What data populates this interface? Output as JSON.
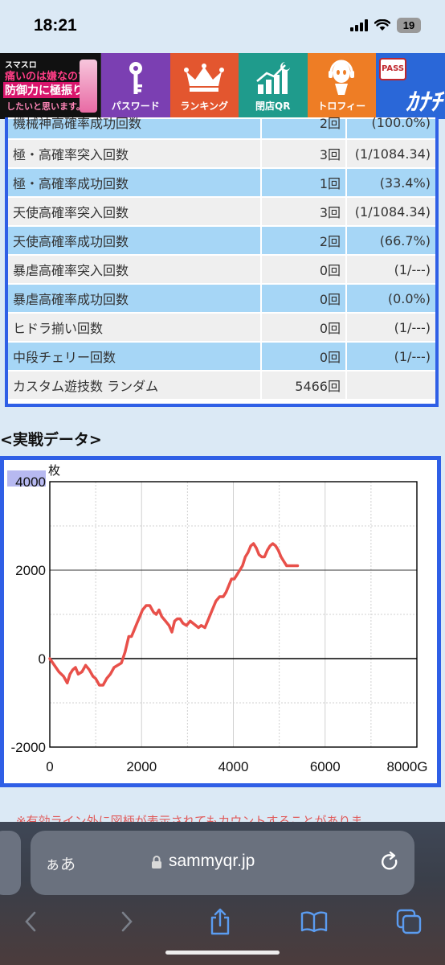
{
  "status": {
    "time": "18:21",
    "battery": "19"
  },
  "nav": {
    "logo_lines": [
      "スマスロ",
      "痛いのは嫌なので",
      "防御力に極振り",
      "したいと思います。"
    ],
    "items": [
      {
        "label": "パスワード",
        "icon": "key-icon"
      },
      {
        "label": "ランキング",
        "icon": "crown-icon"
      },
      {
        "label": "閉店QR",
        "icon": "chart-moon-icon"
      },
      {
        "label": "トロフィー",
        "icon": "headset-character-icon"
      }
    ],
    "brand": {
      "pass": "PASS",
      "kana": "ｶﾅﾁ"
    }
  },
  "table": {
    "rows": [
      {
        "label": "機械神高確率成功回数",
        "count": "2回",
        "rate": "(100.0%)"
      },
      {
        "label": "極・高確率突入回数",
        "count": "3回",
        "rate": "(1/1084.34)"
      },
      {
        "label": "極・高確率成功回数",
        "count": "1回",
        "rate": "(33.4%)"
      },
      {
        "label": "天使高確率突入回数",
        "count": "3回",
        "rate": "(1/1084.34)"
      },
      {
        "label": "天使高確率成功回数",
        "count": "2回",
        "rate": "(66.7%)"
      },
      {
        "label": "暴虐高確率突入回数",
        "count": "0回",
        "rate": "(1/---)"
      },
      {
        "label": "暴虐高確率成功回数",
        "count": "0回",
        "rate": "(0.0%)"
      },
      {
        "label": "ヒドラ揃い回数",
        "count": "0回",
        "rate": "(1/---)"
      },
      {
        "label": "中段チェリー回数",
        "count": "0回",
        "rate": "(1/---)"
      },
      {
        "label": "カスタム遊技数 ランダム",
        "count": "5466回",
        "rate": ""
      }
    ]
  },
  "section_title": "<実戦データ>",
  "chart_data": {
    "type": "line",
    "ylabel": "枚",
    "xlim": [
      0,
      8000
    ],
    "ylim": [
      -2000,
      4000
    ],
    "y_ticks": [
      "4000",
      "2000",
      "0",
      "-2000"
    ],
    "x_ticks": [
      "0",
      "2000",
      "4000",
      "6000",
      "8000G"
    ],
    "grid": true,
    "series": [
      {
        "color": "#e8504a",
        "x": [
          0,
          100,
          200,
          300,
          380,
          440,
          500,
          560,
          620,
          700,
          780,
          860,
          940,
          1000,
          1080,
          1160,
          1240,
          1320,
          1400,
          1480,
          1560,
          1640,
          1720,
          1780,
          1840,
          1900,
          1960,
          2020,
          2100,
          2180,
          2260,
          2320,
          2380,
          2440,
          2520,
          2600,
          2660,
          2720,
          2780,
          2840,
          2900,
          2980,
          3060,
          3120,
          3180,
          3240,
          3300,
          3380,
          3460,
          3540,
          3620,
          3700,
          3780,
          3840,
          3900,
          3960,
          4020,
          4080,
          4140,
          4200,
          4260,
          4320,
          4380,
          4440,
          4500,
          4560,
          4620,
          4680,
          4740,
          4800,
          4860,
          4920,
          4980,
          5040,
          5100,
          5160,
          5220,
          5280,
          5340,
          5400
        ],
        "values": [
          0,
          -150,
          -300,
          -400,
          -550,
          -350,
          -250,
          -200,
          -350,
          -300,
          -150,
          -250,
          -400,
          -450,
          -600,
          -600,
          -450,
          -350,
          -200,
          -150,
          -100,
          150,
          500,
          500,
          650,
          800,
          950,
          1100,
          1200,
          1200,
          1050,
          1000,
          1100,
          950,
          850,
          750,
          600,
          850,
          900,
          900,
          800,
          750,
          850,
          800,
          750,
          700,
          750,
          700,
          900,
          1100,
          1300,
          1400,
          1400,
          1500,
          1650,
          1800,
          1800,
          1900,
          2000,
          2100,
          2300,
          2400,
          2550,
          2600,
          2500,
          2350,
          2300,
          2300,
          2450,
          2550,
          2600,
          2550,
          2450,
          2300,
          2200,
          2100,
          2100,
          2100,
          2100,
          2100
        ]
      }
    ]
  },
  "note": "※有効ライン外に図柄が表示されてもカウントすることがありま",
  "browser": {
    "aa": "ぁあ",
    "url": "sammyqr.jp"
  }
}
